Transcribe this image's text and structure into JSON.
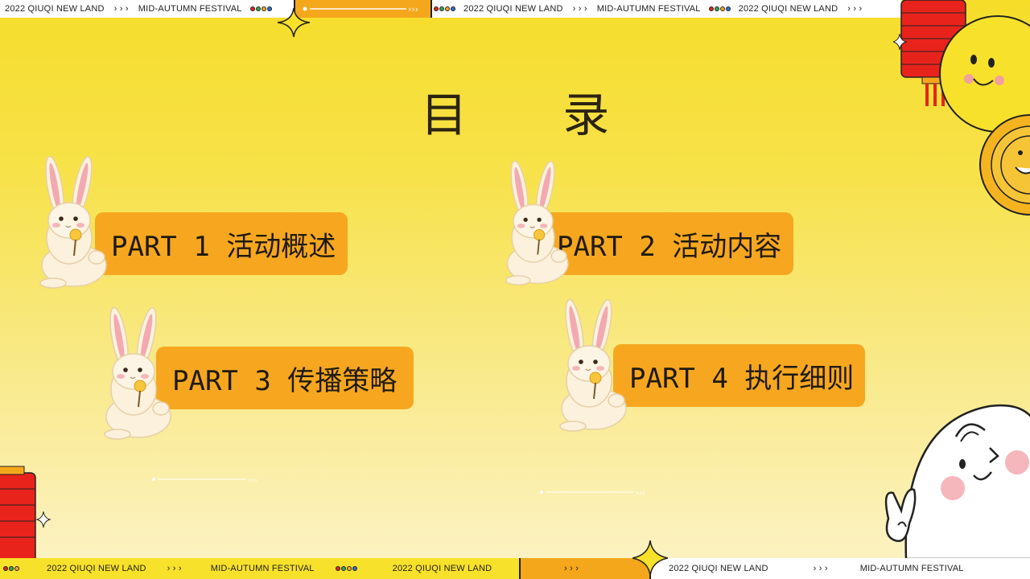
{
  "top_strip": {
    "text_a": "2022 QIUQI NEW LAND",
    "arrows": "› › ›",
    "text_b": "MID-AUTUMN FESTIVAL",
    "text_c": "2022 QIUQI NEW LAND",
    "text_d": "MID-AUTUMN FESTIVAL",
    "text_e": "2022 QIUQI NEW LAND"
  },
  "bottom_strip": {
    "text_a": "2022 QIUQI NEW LAND",
    "arrows": "› › ›",
    "text_b": "MID-AUTUMN FESTIVAL",
    "text_c": "2022 QIUQI NEW LAND",
    "text_d": "2022 QIUQI NEW LAND",
    "text_e": "MID-AUTUMN FESTIVAL"
  },
  "title": "目 录",
  "parts": [
    {
      "label": "PART 1 活动概述"
    },
    {
      "label": "PART 2 活动内容"
    },
    {
      "label": "PART 3 传播策略"
    },
    {
      "label": "PART 4 执行细则"
    }
  ],
  "colors": {
    "accent": "#f6a71f",
    "background": "#f6dd2a",
    "lantern": "#e8231c"
  },
  "icons": [
    "rabbit-icon",
    "lantern-icon",
    "mooncake-icon",
    "cartoon-moon-icon",
    "cartoon-ghost-icon",
    "sparkle-icon"
  ]
}
